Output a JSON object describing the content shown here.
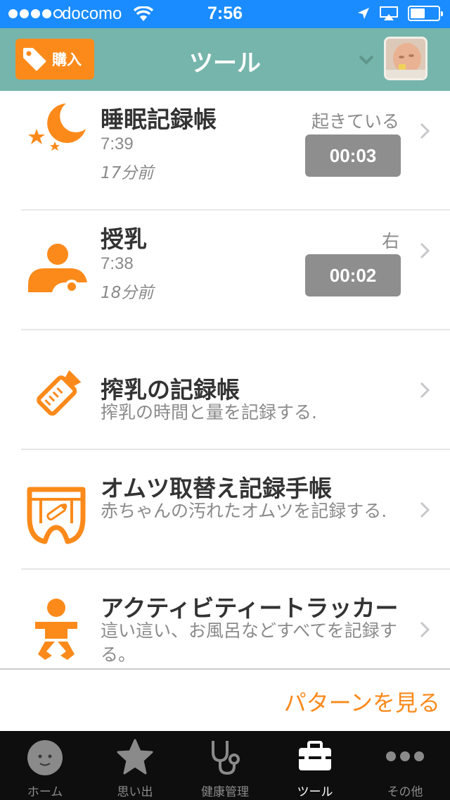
{
  "status_bar": {
    "carrier": "docomo",
    "time": "7:56",
    "signal_bars": 4,
    "signal_max": 5,
    "battery_level": 0.45
  },
  "nav": {
    "buy_label": "購入",
    "title": "ツール"
  },
  "rows": [
    {
      "title": "睡眠記録帳",
      "time": "7:39",
      "ago": "17分前",
      "status": "起きている",
      "timer": "00:03",
      "icon": "moon-stars-icon"
    },
    {
      "title": "授乳",
      "time": "7:38",
      "ago": "18分前",
      "status": "右",
      "timer": "00:02",
      "icon": "breastfeeding-icon"
    },
    {
      "title": "搾乳の記録帳",
      "desc": "搾乳の時間と量を記録する.",
      "icon": "bottle-icon"
    },
    {
      "title": "オムツ取替え記録手帳",
      "desc": "赤ちゃんの汚れたオムツを記録する.",
      "icon": "diaper-icon"
    },
    {
      "title": "アクティビティートラッカー",
      "desc": "這い這い、お風呂などすべてを記録する。",
      "icon": "baby-icon"
    }
  ],
  "pattern_link": "パターンを見る",
  "tabs": [
    {
      "label": "ホーム",
      "icon": "baby-face-icon",
      "active": false
    },
    {
      "label": "思い出",
      "icon": "star-icon",
      "active": false
    },
    {
      "label": "健康管理",
      "icon": "stethoscope-icon",
      "active": false
    },
    {
      "label": "ツール",
      "icon": "toolbox-icon",
      "active": true
    },
    {
      "label": "その他",
      "icon": "more-icon",
      "active": false
    }
  ],
  "colors": {
    "status_bar": "#1a8cff",
    "nav_bar": "#76b5ab",
    "accent": "#fb8a1b",
    "timer_bg": "#8e8e8e",
    "tab_bar": "#0e0e0e"
  }
}
